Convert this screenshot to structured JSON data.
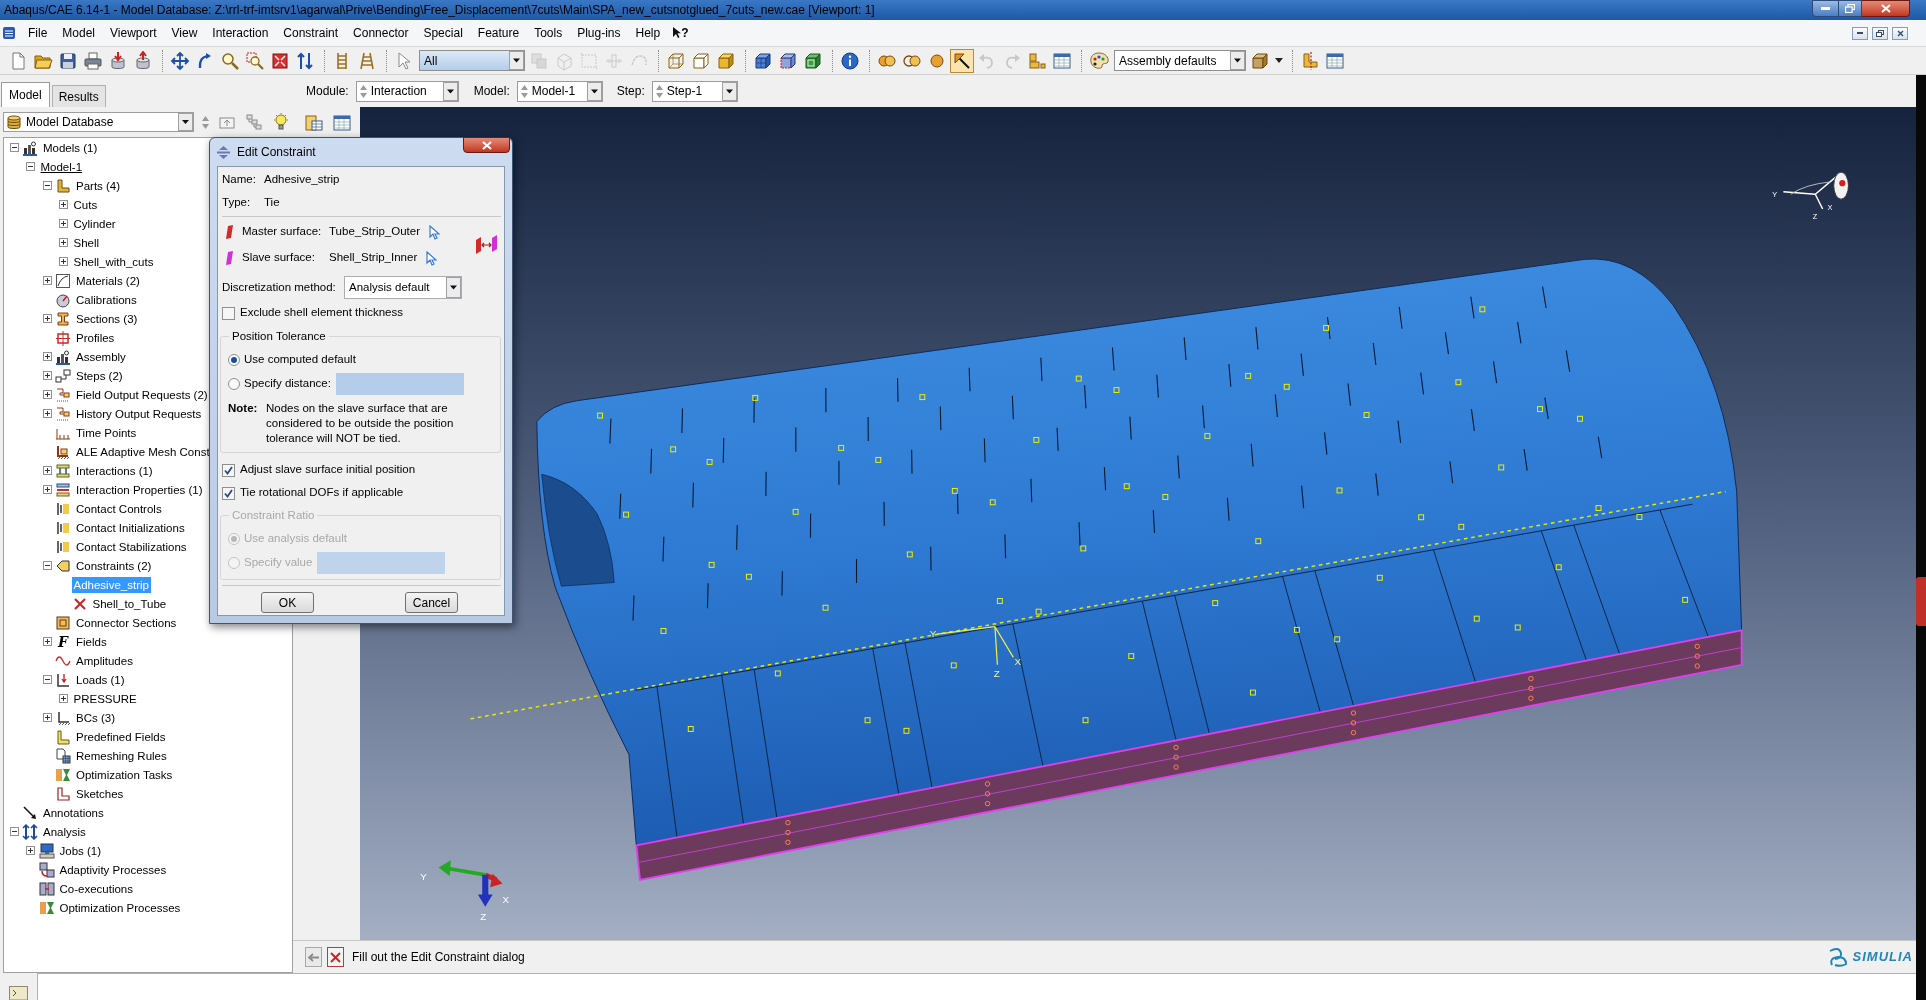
{
  "window": {
    "title": "Abaqus/CAE 6.14-1 - Model Database: Z:\\rrl-trf-imtsrv1\\agarwal\\Prive\\Bending\\Free_Displacement\\7cuts\\Main\\SPA_new_cutsnotglued_7cuts_new.cae [Viewport: 1]"
  },
  "menu": {
    "items": [
      "File",
      "Model",
      "Viewport",
      "View",
      "Interaction",
      "Constraint",
      "Connector",
      "Special",
      "Feature",
      "Tools",
      "Plug-ins",
      "Help"
    ],
    "help_glyph": "?"
  },
  "toolbar": [
    {
      "kind": "new",
      "disabled": false,
      "pressed": false
    },
    {
      "kind": "open",
      "disabled": false,
      "pressed": false
    },
    {
      "kind": "save",
      "disabled": false,
      "pressed": false
    },
    {
      "kind": "print",
      "disabled": false,
      "pressed": false
    },
    {
      "kind": "dbdown",
      "disabled": false,
      "pressed": false
    },
    {
      "kind": "dbup",
      "disabled": false,
      "pressed": false
    },
    {
      "kind": "separator"
    },
    {
      "kind": "pan",
      "disabled": false,
      "pressed": false
    },
    {
      "kind": "rotate",
      "disabled": false,
      "pressed": false
    },
    {
      "kind": "zoom",
      "disabled": false,
      "pressed": false
    },
    {
      "kind": "boxzoom",
      "disabled": false,
      "pressed": false
    },
    {
      "kind": "fit",
      "disabled": false,
      "pressed": false
    },
    {
      "kind": "cycle",
      "disabled": false,
      "pressed": false
    },
    {
      "kind": "separator"
    },
    {
      "kind": "ladder",
      "disabled": false,
      "pressed": false
    },
    {
      "kind": "aframe",
      "disabled": false,
      "pressed": false
    },
    {
      "kind": "separator"
    },
    {
      "kind": "select",
      "disabled": false,
      "pressed": false
    },
    {
      "kind": "combo",
      "value": "All"
    },
    {
      "kind": "pick",
      "disabled": true,
      "pressed": false
    },
    {
      "kind": "pickbox",
      "disabled": true,
      "pressed": false
    },
    {
      "kind": "pickframe",
      "disabled": true,
      "pressed": false
    },
    {
      "kind": "pickedge",
      "disabled": true,
      "pressed": false
    },
    {
      "kind": "pickcurve",
      "disabled": true,
      "pressed": false
    },
    {
      "kind": "separator"
    },
    {
      "kind": "wirecube",
      "disabled": false,
      "pressed": false
    },
    {
      "kind": "hiddencube",
      "disabled": false,
      "pressed": false
    },
    {
      "kind": "shadedcube",
      "disabled": false,
      "pressed": false
    },
    {
      "kind": "separator"
    },
    {
      "kind": "mesh",
      "disabled": false,
      "pressed": false
    },
    {
      "kind": "meshpart",
      "disabled": false,
      "pressed": false
    },
    {
      "kind": "meshframe",
      "disabled": false,
      "pressed": false
    },
    {
      "kind": "separator"
    },
    {
      "kind": "info",
      "disabled": false,
      "pressed": false
    },
    {
      "kind": "separator"
    },
    {
      "kind": "circles",
      "disabled": false,
      "pressed": false
    },
    {
      "kind": "rings",
      "disabled": false,
      "pressed": false
    },
    {
      "kind": "disc",
      "disabled": false,
      "pressed": false
    },
    {
      "kind": "pointer",
      "disabled": false,
      "pressed": true
    },
    {
      "kind": "undo",
      "disabled": true,
      "pressed": false
    },
    {
      "kind": "redo",
      "disabled": true,
      "pressed": false
    },
    {
      "kind": "blocks",
      "disabled": false,
      "pressed": false
    },
    {
      "kind": "table",
      "disabled": false,
      "pressed": false
    },
    {
      "kind": "separator"
    },
    {
      "kind": "palette",
      "disabled": false,
      "pressed": false
    },
    {
      "kind": "combo",
      "value": "Assembly defaults"
    },
    {
      "kind": "solidcube",
      "disabled": false,
      "pressed": false
    },
    {
      "kind": "caret",
      "disabled": false,
      "pressed": false
    },
    {
      "kind": "separator"
    },
    {
      "kind": "lcut",
      "disabled": false,
      "pressed": false
    },
    {
      "kind": "table",
      "disabled": false,
      "pressed": false
    }
  ],
  "context_bar": {
    "tabs": [
      {
        "label": "Model",
        "selected": true
      },
      {
        "label": "Results",
        "selected": false
      }
    ],
    "selectors": [
      {
        "label": "Module:",
        "value": "Interaction"
      },
      {
        "label": "Model:",
        "value": "Model-1"
      },
      {
        "label": "Step:",
        "value": "Step-1"
      }
    ]
  },
  "model_tree": {
    "source": "Model Database",
    "items": [
      {
        "label": "Models (1)",
        "kind": "assembly",
        "expanded": true,
        "selected": false,
        "children": [
          {
            "label": "Model-1",
            "kind": "model",
            "expanded": true,
            "selected": false,
            "children": [
              {
                "label": "Parts (4)",
                "kind": "part",
                "expanded": true,
                "selected": false,
                "children": [
                  {
                    "label": "Cuts",
                    "kind": "plain",
                    "expanded": false,
                    "selected": false
                  },
                  {
                    "label": "Cylinder",
                    "kind": "plain",
                    "expanded": false,
                    "selected": false
                  },
                  {
                    "label": "Shell",
                    "kind": "plain",
                    "expanded": false,
                    "selected": false
                  },
                  {
                    "label": "Shell_with_cuts",
                    "kind": "plain",
                    "expanded": false,
                    "selected": false
                  }
                ]
              },
              {
                "label": "Materials (2)",
                "kind": "material",
                "expanded": false,
                "selected": false
              },
              {
                "label": "Calibrations",
                "kind": "calibration",
                "selected": false
              },
              {
                "label": "Sections (3)",
                "kind": "section",
                "expanded": false,
                "selected": false
              },
              {
                "label": "Profiles",
                "kind": "profile",
                "selected": false
              },
              {
                "label": "Assembly",
                "kind": "assembly",
                "expanded": false,
                "selected": false
              },
              {
                "label": "Steps (2)",
                "kind": "step",
                "expanded": false,
                "selected": false
              },
              {
                "label": "Field Output Requests (2)",
                "kind": "output",
                "expanded": false,
                "selected": false
              },
              {
                "label": "History Output Requests",
                "kind": "output",
                "expanded": false,
                "selected": false
              },
              {
                "label": "Time Points",
                "kind": "time",
                "selected": false
              },
              {
                "label": "ALE Adaptive Mesh Const",
                "kind": "mesh",
                "selected": false
              },
              {
                "label": "Interactions (1)",
                "kind": "interaction",
                "expanded": false,
                "selected": false
              },
              {
                "label": "Interaction Properties (1)",
                "kind": "property",
                "expanded": false,
                "selected": false
              },
              {
                "label": "Contact Controls",
                "kind": "contact",
                "selected": false
              },
              {
                "label": "Contact Initializations",
                "kind": "contact",
                "selected": false
              },
              {
                "label": "Contact Stabilizations",
                "kind": "contact",
                "selected": false
              },
              {
                "label": "Constraints (2)",
                "kind": "constraint",
                "expanded": true,
                "selected": false,
                "children": [
                  {
                    "label": "Adhesive_strip",
                    "kind": "plain",
                    "selected": true
                  },
                  {
                    "label": "Shell_to_Tube",
                    "kind": "cross",
                    "selected": false
                  }
                ]
              },
              {
                "label": "Connector Sections",
                "kind": "connector",
                "selected": false
              },
              {
                "label": "Fields",
                "kind": "field",
                "glyph": "F",
                "expanded": false,
                "selected": false
              },
              {
                "label": "Amplitudes",
                "kind": "amplitude",
                "selected": false
              },
              {
                "label": "Loads (1)",
                "kind": "load",
                "expanded": true,
                "selected": false,
                "children": [
                  {
                    "label": "PRESSURE",
                    "kind": "plain",
                    "expanded": false,
                    "selected": false
                  }
                ]
              },
              {
                "label": "BCs (3)",
                "kind": "bc",
                "expanded": false,
                "selected": false
              },
              {
                "label": "Predefined Fields",
                "kind": "predefined",
                "selected": false
              },
              {
                "label": "Remeshing Rules",
                "kind": "remesh",
                "selected": false
              },
              {
                "label": "Optimization Tasks",
                "kind": "optimization",
                "selected": false
              },
              {
                "label": "Sketches",
                "kind": "sketch",
                "selected": false
              }
            ]
          }
        ]
      },
      {
        "label": "Annotations",
        "kind": "annotation",
        "selected": false
      },
      {
        "label": "Analysis",
        "kind": "analysis",
        "expanded": true,
        "selected": false,
        "children": [
          {
            "label": "Jobs (1)",
            "kind": "job",
            "expanded": false,
            "selected": false
          },
          {
            "label": "Adaptivity Processes",
            "kind": "adaptivity",
            "selected": false
          },
          {
            "label": "Co-executions",
            "kind": "coexec",
            "selected": false
          },
          {
            "label": "Optimization Processes",
            "kind": "optimization",
            "selected": false
          }
        ]
      }
    ]
  },
  "edit_constraint_dialog": {
    "title": "Edit Constraint",
    "fields": [
      {
        "label": "Name:",
        "value": "Adhesive_strip"
      },
      {
        "label": "Type:",
        "value": "Tie"
      }
    ],
    "surfaces": [
      {
        "label": "Master surface:",
        "value": "Tube_Strip_Outer",
        "color": "#d42a2a"
      },
      {
        "label": "Slave surface:",
        "value": "Shell_Strip_Inner",
        "color": "#d030d8"
      }
    ],
    "discretization": {
      "label": "Discretization method:",
      "value": "Analysis default"
    },
    "exclude_shell_thickness": {
      "label": "Exclude shell element thickness",
      "checked": false
    },
    "position_tolerance": {
      "title": "Position Tolerance",
      "options": [
        {
          "label": "Use computed default",
          "kind": "plain",
          "selected": true
        },
        {
          "label": "Specify distance:",
          "kind": "entry",
          "selected": false
        }
      ],
      "note_label": "Note:",
      "note": "Nodes on the slave surface that are considered to be outside the position tolerance will NOT be tied."
    },
    "checks": [
      {
        "label": "Adjust slave surface initial position",
        "checked": true
      },
      {
        "label": "Tie rotational DOFs if applicable",
        "checked": true
      }
    ],
    "constraint_ratio": {
      "title": "Constraint Ratio",
      "disabled": true,
      "options": [
        {
          "label": "Use analysis default",
          "kind": "plain",
          "selected": true
        },
        {
          "label": "Specify value",
          "kind": "entry",
          "selected": false
        }
      ]
    },
    "buttons": [
      "OK",
      "Cancel"
    ]
  },
  "viewport": {
    "reference_axis_labels": [
      "Y",
      "Z",
      "X"
    ],
    "view_triad_labels": [
      "Y",
      "Z",
      "X"
    ],
    "global_triad_labels": [
      "Y",
      "X",
      "Z"
    ]
  },
  "prompt": "Fill out the Edit Constraint dialog",
  "brand": "SIMULIA"
}
